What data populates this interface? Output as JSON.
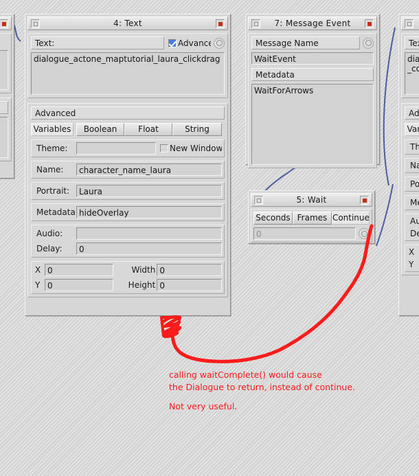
{
  "canvas": {
    "background_color": "#d4d4d4",
    "annotation_color": "#fc1b1b",
    "wire_color": "#4a5d9e"
  },
  "nodes": {
    "text": {
      "title": "4: Text",
      "minimize_icon": "minimize-icon",
      "close_icon": "close-icon",
      "text_label": "Text:",
      "advanced_checkbox_label": "Advanced",
      "advanced_checked": true,
      "output_port_icon": "output-port-icon",
      "body_value": "dialogue_actone_maptutorial_laura_clickdrag",
      "advanced_header": "Advanced",
      "tabs": [
        "Variables",
        "Boolean",
        "Float",
        "String"
      ],
      "active_tab": "Variables",
      "theme_label": "Theme:",
      "theme_value": "",
      "new_window_label": "New Window",
      "new_window_checked": false,
      "name_label": "Name:",
      "name_value": "character_name_laura",
      "portrait_label": "Portrait:",
      "portrait_value": "Laura",
      "metadata_label": "Metadata:",
      "metadata_value": "hideOverlay",
      "audio_label": "Audio:",
      "audio_value": "",
      "delay_label": "Delay:",
      "delay_value": "0",
      "x_label": "X",
      "x_value": "0",
      "y_label": "Y",
      "y_value": "0",
      "width_label": "Width",
      "width_value": "0",
      "height_label": "Height",
      "height_value": "0"
    },
    "message_event": {
      "title": "7: Message Event",
      "minimize_icon": "minimize-icon",
      "close_icon": "close-icon",
      "message_name_label": "Message Name",
      "output_port_icon": "output-port-icon",
      "message_name_value": "WaitEvent",
      "metadata_label": "Metadata",
      "metadata_value": "WaitForArrows"
    },
    "wait": {
      "title": "5: Wait",
      "minimize_icon": "minimize-icon",
      "close_icon": "close-icon",
      "tabs": [
        "Seconds",
        "Frames",
        "Continue"
      ],
      "active_tab": "Continue",
      "value": "0",
      "output_port_icon": "output-port-icon"
    },
    "left_partial": {
      "close_icon": "close-icon",
      "output_port_icon": "output-port-icon"
    },
    "right_partial": {
      "title": "",
      "minimize_icon": "minimize-icon",
      "text_label": "Text:",
      "body_value": "dialogue_actone_maptutorial_laura_clickdrag_complete",
      "advanced_header": "Advanced",
      "tabs": [
        "Variables"
      ],
      "theme_label": "Theme:",
      "name_label": "Name:",
      "portrait_label": "Portrait:",
      "metadata_label": "Metadata:",
      "audio_label": "Audio:",
      "delay_label": "Delay:",
      "x_label": "X",
      "y_label": "Y"
    }
  },
  "annotation": {
    "line1": "calling waitComplete() would cause",
    "line2": "the Dialogue to return, instead of continue.",
    "line3": "Not very useful.",
    "arrow_icon": "red-arrow-annotation"
  }
}
